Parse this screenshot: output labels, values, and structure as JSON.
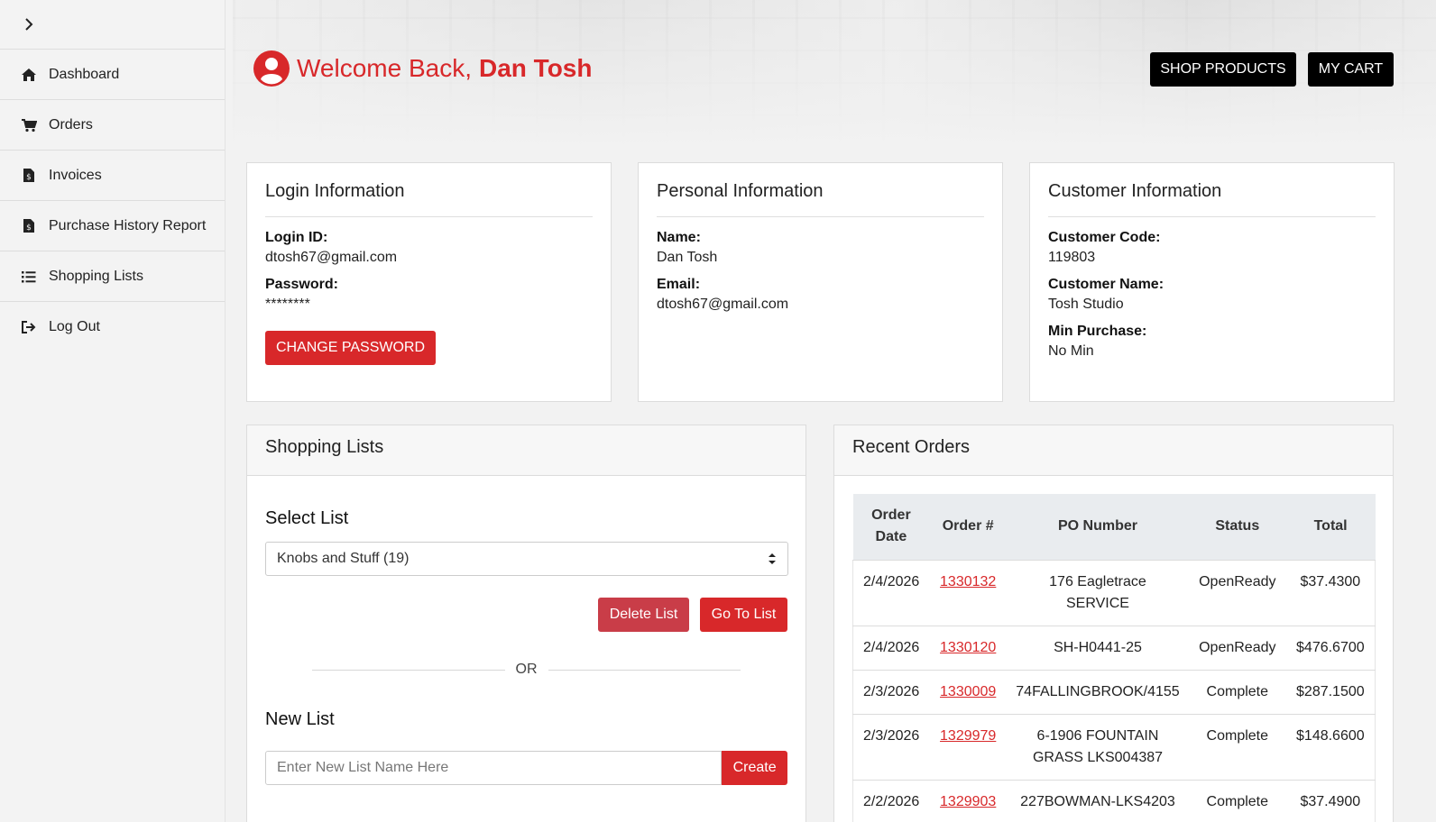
{
  "sidebar": {
    "items": [
      {
        "label": "Dashboard",
        "icon": "home-icon"
      },
      {
        "label": "Orders",
        "icon": "cart-icon"
      },
      {
        "label": "Invoices",
        "icon": "invoice-icon"
      },
      {
        "label": "Purchase History Report",
        "icon": "report-icon"
      },
      {
        "label": "Shopping Lists",
        "icon": "list-icon"
      },
      {
        "label": "Log Out",
        "icon": "logout-icon"
      }
    ]
  },
  "header": {
    "greeting": "Welcome Back,",
    "user_name": "Dan Tosh",
    "shop_label": "SHOP PRODUCTS",
    "cart_label": "MY CART"
  },
  "login": {
    "title": "Login Information",
    "id_label": "Login ID:",
    "id_value": "dtosh67@gmail.com",
    "password_label": "Password:",
    "password_value": "********",
    "change_label": "CHANGE PASSWORD"
  },
  "personal": {
    "title": "Personal Information",
    "name_label": "Name:",
    "name_value": "Dan Tosh",
    "email_label": "Email:",
    "email_value": "dtosh67@gmail.com"
  },
  "customer": {
    "title": "Customer Information",
    "code_label": "Customer Code:",
    "code_value": "119803",
    "name_label": "Customer Name:",
    "name_value": "Tosh Studio",
    "min_label": "Min Purchase:",
    "min_value": "No Min"
  },
  "shopping_lists": {
    "title": "Shopping Lists",
    "select_title": "Select List",
    "selected": "Knobs and Stuff (19)",
    "delete_label": "Delete List",
    "go_label": "Go To List",
    "or_label": "OR",
    "new_title": "New List",
    "new_placeholder": "Enter New List Name Here",
    "create_label": "Create"
  },
  "recent_orders": {
    "title": "Recent Orders",
    "headers": {
      "date_line1": "Order",
      "date_line2": "Date",
      "order": "Order #",
      "po": "PO Number",
      "status": "Status",
      "total": "Total"
    },
    "rows": [
      {
        "date": "2/4/2026",
        "order": "1330132",
        "po_line1": "176 Eagletrace",
        "po_line2": "SERVICE",
        "status": "OpenReady",
        "total": "$37.4300"
      },
      {
        "date": "2/4/2026",
        "order": "1330120",
        "po_line1": "SH-H0441-25",
        "po_line2": "",
        "status": "OpenReady",
        "total": "$476.6700"
      },
      {
        "date": "2/3/2026",
        "order": "1330009",
        "po_line1": "74FALLINGBROOK/4155",
        "po_line2": "",
        "status": "Complete",
        "total": "$287.1500"
      },
      {
        "date": "2/3/2026",
        "order": "1329979",
        "po_line1": "6-1906 FOUNTAIN",
        "po_line2": "GRASS LKS004387",
        "status": "Complete",
        "total": "$148.6600"
      },
      {
        "date": "2/2/2026",
        "order": "1329903",
        "po_line1": "227BOWMAN-LKS4203",
        "po_line2": "",
        "status": "Complete",
        "total": "$37.4900"
      }
    ]
  },
  "colors": {
    "brand_red": "#d8282a",
    "delete_red": "#c93d48",
    "black": "#000000"
  }
}
